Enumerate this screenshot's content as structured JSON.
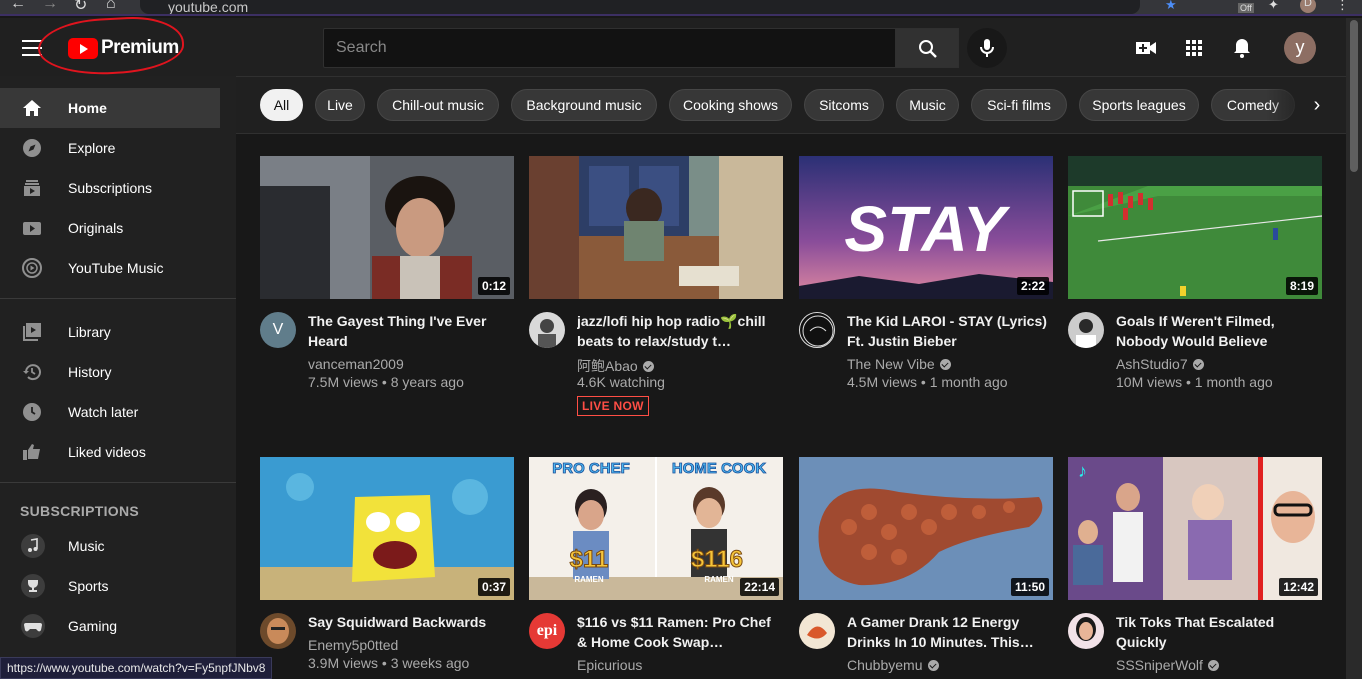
{
  "browser": {
    "url": "youtube.com",
    "status_url": "https://www.youtube.com/watch?v=Fy5npfJNbv8",
    "ext_badge": "Off",
    "profile_initial": "D"
  },
  "masthead": {
    "logo_text": "Premium",
    "search_placeholder": "Search",
    "avatar_initial": "y"
  },
  "sidebar": {
    "main": [
      {
        "label": "Home",
        "icon": "home-icon"
      },
      {
        "label": "Explore",
        "icon": "compass-icon"
      },
      {
        "label": "Subscriptions",
        "icon": "subscriptions-icon"
      },
      {
        "label": "Originals",
        "icon": "originals-icon"
      },
      {
        "label": "YouTube Music",
        "icon": "youtube-music-icon"
      }
    ],
    "library": [
      {
        "label": "Library",
        "icon": "library-icon"
      },
      {
        "label": "History",
        "icon": "history-icon"
      },
      {
        "label": "Watch later",
        "icon": "clock-icon"
      },
      {
        "label": "Liked videos",
        "icon": "thumbs-up-icon"
      }
    ],
    "subscriptions_heading": "SUBSCRIPTIONS",
    "subscriptions": [
      {
        "label": "Music",
        "icon": "music-note-icon"
      },
      {
        "label": "Sports",
        "icon": "trophy-icon"
      },
      {
        "label": "Gaming",
        "icon": "gamepad-icon"
      }
    ]
  },
  "chips": [
    "All",
    "Live",
    "Chill-out music",
    "Background music",
    "Cooking shows",
    "Sitcoms",
    "Music",
    "Sci-fi films",
    "Sports leagues",
    "Comedy"
  ],
  "videos": [
    {
      "title": "The Gayest Thing I've Ever Heard",
      "channel": "vanceman2009",
      "verified": false,
      "meta": "7.5M views • 8 years ago",
      "duration": "0:12",
      "avatar_letter": "V",
      "live": ""
    },
    {
      "title": "jazz/lofi hip hop radio🌱chill beats to relax/study t…",
      "channel": "阿鲍Abao",
      "verified": true,
      "meta": "4.6K watching",
      "duration": "",
      "avatar_letter": "",
      "live": "LIVE NOW"
    },
    {
      "title": "The Kid LAROI - STAY (Lyrics) Ft. Justin Bieber",
      "channel": "The New Vibe",
      "verified": true,
      "meta": "4.5M views • 1 month ago",
      "duration": "2:22",
      "avatar_letter": "",
      "live": "",
      "thumb_text": "STAY"
    },
    {
      "title": "Goals If Weren't Filmed, Nobody Would Believe",
      "channel": "AshStudio7",
      "verified": true,
      "meta": "10M views • 1 month ago",
      "duration": "8:19",
      "avatar_letter": "",
      "live": ""
    },
    {
      "title": "Say Squidward Backwards",
      "channel": "Enemy5p0tted",
      "verified": false,
      "meta": "3.9M views • 3 weeks ago",
      "duration": "0:37",
      "avatar_letter": "",
      "live": ""
    },
    {
      "title": "$116 vs $11 Ramen: Pro Chef & Home Cook Swap…",
      "channel": "Epicurious",
      "verified": true,
      "meta": "",
      "duration": "22:14",
      "avatar_letter": "epi",
      "live": "",
      "thumb_left": "PRO CHEF",
      "thumb_right": "HOME COOK",
      "price_left": "$11",
      "price_right": "$116",
      "ramen": "RAMEN"
    },
    {
      "title": "A Gamer Drank 12 Energy Drinks In 10 Minutes. This…",
      "channel": "Chubbyemu",
      "verified": true,
      "meta": "",
      "duration": "11:50",
      "avatar_letter": "",
      "live": ""
    },
    {
      "title": "Tik Toks That Escalated Quickly",
      "channel": "SSSniperWolf",
      "verified": true,
      "meta": "",
      "duration": "12:42",
      "avatar_letter": "",
      "live": ""
    }
  ],
  "colors": {
    "accent_red": "#ff0000",
    "annotation_red": "#e0141e",
    "live_red": "#ff4e45",
    "bg": "#181818",
    "sidebar_bg": "#212121"
  }
}
